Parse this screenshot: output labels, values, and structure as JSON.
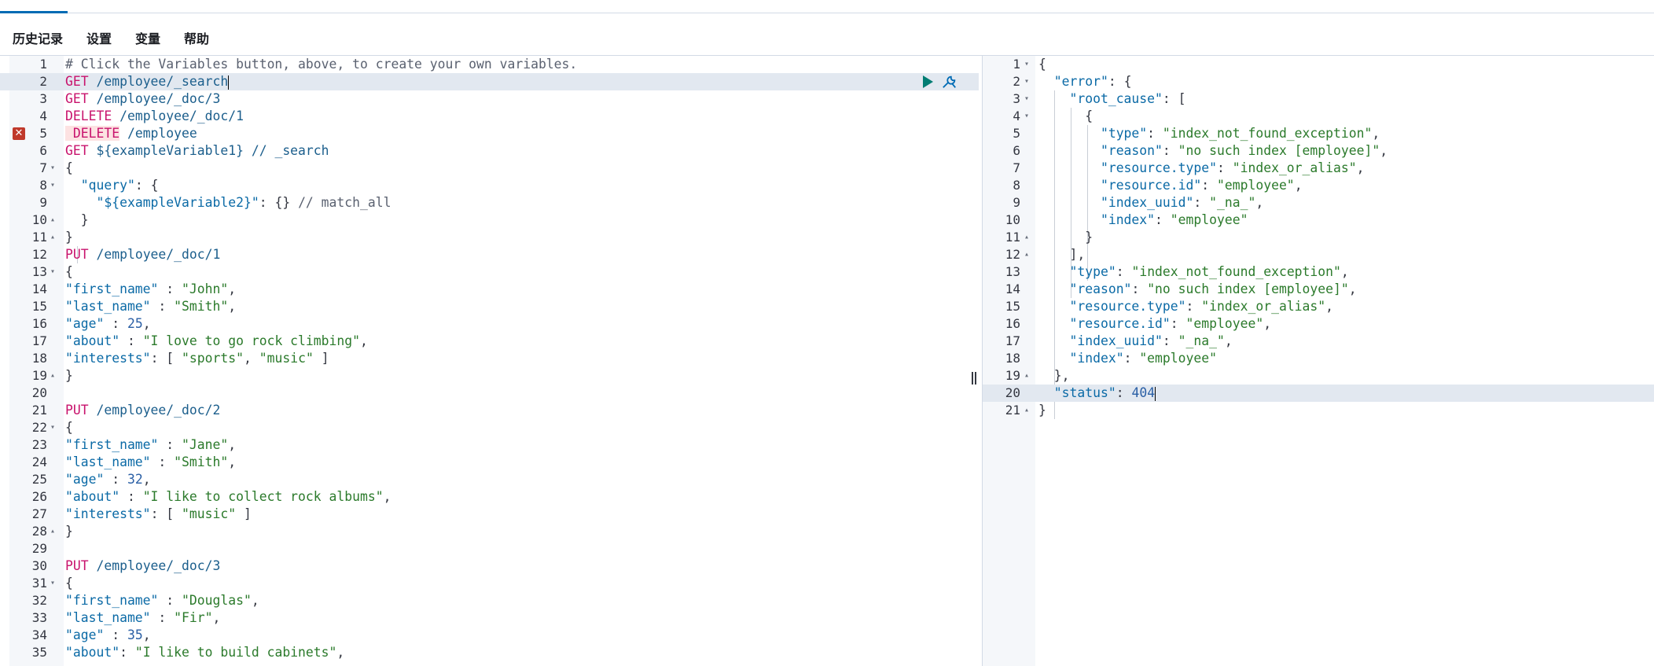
{
  "toolbar": {
    "history": "历史记录",
    "settings": "设置",
    "variables": "变量",
    "help": "帮助"
  },
  "request_editor": {
    "lines": [
      {
        "n": "1",
        "fold": "",
        "tokens": [
          {
            "c": "comment",
            "t": "# Click the Variables button, above, to create your own variables."
          }
        ]
      },
      {
        "n": "2",
        "fold": "",
        "tokens": [
          {
            "c": "method",
            "t": "GET"
          },
          {
            "c": "punct",
            "t": " "
          },
          {
            "c": "url",
            "t": "/employee/_search"
          }
        ]
      },
      {
        "n": "3",
        "fold": "",
        "tokens": [
          {
            "c": "method",
            "t": "GET"
          },
          {
            "c": "punct",
            "t": " "
          },
          {
            "c": "url",
            "t": "/employee/_doc/3"
          }
        ]
      },
      {
        "n": "4",
        "fold": "",
        "tokens": [
          {
            "c": "method",
            "t": "DELETE"
          },
          {
            "c": "punct",
            "t": " "
          },
          {
            "c": "url",
            "t": "/employee/_doc/1"
          }
        ]
      },
      {
        "n": "5",
        "fold": "",
        "tokens": [
          {
            "c": "method",
            "t": " DELETE"
          },
          {
            "c": "punct",
            "t": " "
          },
          {
            "c": "url",
            "t": "/employee"
          }
        ]
      },
      {
        "n": "6",
        "fold": "",
        "tokens": [
          {
            "c": "method",
            "t": "GET"
          },
          {
            "c": "punct",
            "t": " "
          },
          {
            "c": "url",
            "t": "${exampleVariable1} // _search"
          }
        ]
      },
      {
        "n": "7",
        "fold": "▾",
        "tokens": [
          {
            "c": "punct",
            "t": "{"
          }
        ]
      },
      {
        "n": "8",
        "fold": "▾",
        "tokens": [
          {
            "c": "punct",
            "t": "  "
          },
          {
            "c": "key",
            "t": "\"query\""
          },
          {
            "c": "punct",
            "t": ": {"
          }
        ]
      },
      {
        "n": "9",
        "fold": "",
        "tokens": [
          {
            "c": "punct",
            "t": "    "
          },
          {
            "c": "key",
            "t": "\"${exampleVariable2}\""
          },
          {
            "c": "punct",
            "t": ": {} "
          },
          {
            "c": "comment",
            "t": "// match_all"
          }
        ]
      },
      {
        "n": "10",
        "fold": "▴",
        "tokens": [
          {
            "c": "punct",
            "t": "  }"
          }
        ]
      },
      {
        "n": "11",
        "fold": "▴",
        "tokens": [
          {
            "c": "punct",
            "t": "}"
          }
        ]
      },
      {
        "n": "12",
        "fold": "",
        "tokens": [
          {
            "c": "method",
            "t": "PUT"
          },
          {
            "c": "punct",
            "t": " "
          },
          {
            "c": "url",
            "t": "/employee/_doc/1"
          }
        ]
      },
      {
        "n": "13",
        "fold": "▾",
        "tokens": [
          {
            "c": "punct",
            "t": "{"
          }
        ]
      },
      {
        "n": "14",
        "fold": "",
        "tokens": [
          {
            "c": "key",
            "t": "\"first_name\""
          },
          {
            "c": "punct",
            "t": " : "
          },
          {
            "c": "str",
            "t": "\"John\""
          },
          {
            "c": "punct",
            "t": ","
          }
        ]
      },
      {
        "n": "15",
        "fold": "",
        "tokens": [
          {
            "c": "key",
            "t": "\"last_name\""
          },
          {
            "c": "punct",
            "t": " : "
          },
          {
            "c": "str",
            "t": "\"Smith\""
          },
          {
            "c": "punct",
            "t": ","
          }
        ]
      },
      {
        "n": "16",
        "fold": "",
        "tokens": [
          {
            "c": "key",
            "t": "\"age\""
          },
          {
            "c": "punct",
            "t": " : "
          },
          {
            "c": "num",
            "t": "25"
          },
          {
            "c": "punct",
            "t": ","
          }
        ]
      },
      {
        "n": "17",
        "fold": "",
        "tokens": [
          {
            "c": "key",
            "t": "\"about\""
          },
          {
            "c": "punct",
            "t": " : "
          },
          {
            "c": "str",
            "t": "\"I love to go rock climbing\""
          },
          {
            "c": "punct",
            "t": ","
          }
        ]
      },
      {
        "n": "18",
        "fold": "",
        "tokens": [
          {
            "c": "key",
            "t": "\"interests\""
          },
          {
            "c": "punct",
            "t": ": [ "
          },
          {
            "c": "str",
            "t": "\"sports\""
          },
          {
            "c": "punct",
            "t": ", "
          },
          {
            "c": "str",
            "t": "\"music\""
          },
          {
            "c": "punct",
            "t": " ]"
          }
        ]
      },
      {
        "n": "19",
        "fold": "▴",
        "tokens": [
          {
            "c": "punct",
            "t": "}"
          }
        ]
      },
      {
        "n": "20",
        "fold": "",
        "tokens": []
      },
      {
        "n": "21",
        "fold": "",
        "tokens": [
          {
            "c": "method",
            "t": "PUT"
          },
          {
            "c": "punct",
            "t": " "
          },
          {
            "c": "url",
            "t": "/employee/_doc/2"
          }
        ]
      },
      {
        "n": "22",
        "fold": "▾",
        "tokens": [
          {
            "c": "punct",
            "t": "{"
          }
        ]
      },
      {
        "n": "23",
        "fold": "",
        "tokens": [
          {
            "c": "key",
            "t": "\"first_name\""
          },
          {
            "c": "punct",
            "t": " : "
          },
          {
            "c": "str",
            "t": "\"Jane\""
          },
          {
            "c": "punct",
            "t": ","
          }
        ]
      },
      {
        "n": "24",
        "fold": "",
        "tokens": [
          {
            "c": "key",
            "t": "\"last_name\""
          },
          {
            "c": "punct",
            "t": " : "
          },
          {
            "c": "str",
            "t": "\"Smith\""
          },
          {
            "c": "punct",
            "t": ","
          }
        ]
      },
      {
        "n": "25",
        "fold": "",
        "tokens": [
          {
            "c": "key",
            "t": "\"age\""
          },
          {
            "c": "punct",
            "t": " : "
          },
          {
            "c": "num",
            "t": "32"
          },
          {
            "c": "punct",
            "t": ","
          }
        ]
      },
      {
        "n": "26",
        "fold": "",
        "tokens": [
          {
            "c": "key",
            "t": "\"about\""
          },
          {
            "c": "punct",
            "t": " : "
          },
          {
            "c": "str",
            "t": "\"I like to collect rock albums\""
          },
          {
            "c": "punct",
            "t": ","
          }
        ]
      },
      {
        "n": "27",
        "fold": "",
        "tokens": [
          {
            "c": "key",
            "t": "\"interests\""
          },
          {
            "c": "punct",
            "t": ": [ "
          },
          {
            "c": "str",
            "t": "\"music\""
          },
          {
            "c": "punct",
            "t": " ]"
          }
        ]
      },
      {
        "n": "28",
        "fold": "▴",
        "tokens": [
          {
            "c": "punct",
            "t": "}"
          }
        ]
      },
      {
        "n": "29",
        "fold": "",
        "tokens": []
      },
      {
        "n": "30",
        "fold": "",
        "tokens": [
          {
            "c": "method",
            "t": "PUT"
          },
          {
            "c": "punct",
            "t": " "
          },
          {
            "c": "url",
            "t": "/employee/_doc/3"
          }
        ]
      },
      {
        "n": "31",
        "fold": "▾",
        "tokens": [
          {
            "c": "punct",
            "t": "{"
          }
        ]
      },
      {
        "n": "32",
        "fold": "",
        "tokens": [
          {
            "c": "key",
            "t": "\"first_name\""
          },
          {
            "c": "punct",
            "t": " : "
          },
          {
            "c": "str",
            "t": "\"Douglas\""
          },
          {
            "c": "punct",
            "t": ","
          }
        ]
      },
      {
        "n": "33",
        "fold": "",
        "tokens": [
          {
            "c": "key",
            "t": "\"last_name\""
          },
          {
            "c": "punct",
            "t": " : "
          },
          {
            "c": "str",
            "t": "\"Fir\""
          },
          {
            "c": "punct",
            "t": ","
          }
        ]
      },
      {
        "n": "34",
        "fold": "",
        "tokens": [
          {
            "c": "key",
            "t": "\"age\""
          },
          {
            "c": "punct",
            "t": " : "
          },
          {
            "c": "num",
            "t": "35"
          },
          {
            "c": "punct",
            "t": ","
          }
        ]
      },
      {
        "n": "35",
        "fold": "",
        "tokens": [
          {
            "c": "key",
            "t": "\"about\""
          },
          {
            "c": "punct",
            "t": ": "
          },
          {
            "c": "str",
            "t": "\"I like to build cabinets\""
          },
          {
            "c": "punct",
            "t": ","
          }
        ]
      }
    ]
  },
  "response_viewer": {
    "lines": [
      {
        "n": "1",
        "fold": "▾",
        "tokens": [
          {
            "c": "punct",
            "t": "{"
          }
        ]
      },
      {
        "n": "2",
        "fold": "▾",
        "tokens": [
          {
            "c": "punct",
            "t": "  "
          },
          {
            "c": "key",
            "t": "\"error\""
          },
          {
            "c": "punct",
            "t": ": {"
          }
        ]
      },
      {
        "n": "3",
        "fold": "▾",
        "tokens": [
          {
            "c": "punct",
            "t": "    "
          },
          {
            "c": "key",
            "t": "\"root_cause\""
          },
          {
            "c": "punct",
            "t": ": ["
          }
        ]
      },
      {
        "n": "4",
        "fold": "▾",
        "tokens": [
          {
            "c": "punct",
            "t": "      {"
          }
        ]
      },
      {
        "n": "5",
        "fold": "",
        "tokens": [
          {
            "c": "punct",
            "t": "        "
          },
          {
            "c": "key",
            "t": "\"type\""
          },
          {
            "c": "punct",
            "t": ": "
          },
          {
            "c": "str",
            "t": "\"index_not_found_exception\""
          },
          {
            "c": "punct",
            "t": ","
          }
        ]
      },
      {
        "n": "6",
        "fold": "",
        "tokens": [
          {
            "c": "punct",
            "t": "        "
          },
          {
            "c": "key",
            "t": "\"reason\""
          },
          {
            "c": "punct",
            "t": ": "
          },
          {
            "c": "str",
            "t": "\"no such index [employee]\""
          },
          {
            "c": "punct",
            "t": ","
          }
        ]
      },
      {
        "n": "7",
        "fold": "",
        "tokens": [
          {
            "c": "punct",
            "t": "        "
          },
          {
            "c": "key",
            "t": "\"resource.type\""
          },
          {
            "c": "punct",
            "t": ": "
          },
          {
            "c": "str",
            "t": "\"index_or_alias\""
          },
          {
            "c": "punct",
            "t": ","
          }
        ]
      },
      {
        "n": "8",
        "fold": "",
        "tokens": [
          {
            "c": "punct",
            "t": "        "
          },
          {
            "c": "key",
            "t": "\"resource.id\""
          },
          {
            "c": "punct",
            "t": ": "
          },
          {
            "c": "str",
            "t": "\"employee\""
          },
          {
            "c": "punct",
            "t": ","
          }
        ]
      },
      {
        "n": "9",
        "fold": "",
        "tokens": [
          {
            "c": "punct",
            "t": "        "
          },
          {
            "c": "key",
            "t": "\"index_uuid\""
          },
          {
            "c": "punct",
            "t": ": "
          },
          {
            "c": "str",
            "t": "\"_na_\""
          },
          {
            "c": "punct",
            "t": ","
          }
        ]
      },
      {
        "n": "10",
        "fold": "",
        "tokens": [
          {
            "c": "punct",
            "t": "        "
          },
          {
            "c": "key",
            "t": "\"index\""
          },
          {
            "c": "punct",
            "t": ": "
          },
          {
            "c": "str",
            "t": "\"employee\""
          }
        ]
      },
      {
        "n": "11",
        "fold": "▴",
        "tokens": [
          {
            "c": "punct",
            "t": "      }"
          }
        ]
      },
      {
        "n": "12",
        "fold": "▴",
        "tokens": [
          {
            "c": "punct",
            "t": "    ],"
          }
        ]
      },
      {
        "n": "13",
        "fold": "",
        "tokens": [
          {
            "c": "punct",
            "t": "    "
          },
          {
            "c": "key",
            "t": "\"type\""
          },
          {
            "c": "punct",
            "t": ": "
          },
          {
            "c": "str",
            "t": "\"index_not_found_exception\""
          },
          {
            "c": "punct",
            "t": ","
          }
        ]
      },
      {
        "n": "14",
        "fold": "",
        "tokens": [
          {
            "c": "punct",
            "t": "    "
          },
          {
            "c": "key",
            "t": "\"reason\""
          },
          {
            "c": "punct",
            "t": ": "
          },
          {
            "c": "str",
            "t": "\"no such index [employee]\""
          },
          {
            "c": "punct",
            "t": ","
          }
        ]
      },
      {
        "n": "15",
        "fold": "",
        "tokens": [
          {
            "c": "punct",
            "t": "    "
          },
          {
            "c": "key",
            "t": "\"resource.type\""
          },
          {
            "c": "punct",
            "t": ": "
          },
          {
            "c": "str",
            "t": "\"index_or_alias\""
          },
          {
            "c": "punct",
            "t": ","
          }
        ]
      },
      {
        "n": "16",
        "fold": "",
        "tokens": [
          {
            "c": "punct",
            "t": "    "
          },
          {
            "c": "key",
            "t": "\"resource.id\""
          },
          {
            "c": "punct",
            "t": ": "
          },
          {
            "c": "str",
            "t": "\"employee\""
          },
          {
            "c": "punct",
            "t": ","
          }
        ]
      },
      {
        "n": "17",
        "fold": "",
        "tokens": [
          {
            "c": "punct",
            "t": "    "
          },
          {
            "c": "key",
            "t": "\"index_uuid\""
          },
          {
            "c": "punct",
            "t": ": "
          },
          {
            "c": "str",
            "t": "\"_na_\""
          },
          {
            "c": "punct",
            "t": ","
          }
        ]
      },
      {
        "n": "18",
        "fold": "",
        "tokens": [
          {
            "c": "punct",
            "t": "    "
          },
          {
            "c": "key",
            "t": "\"index\""
          },
          {
            "c": "punct",
            "t": ": "
          },
          {
            "c": "str",
            "t": "\"employee\""
          }
        ]
      },
      {
        "n": "19",
        "fold": "▴",
        "tokens": [
          {
            "c": "punct",
            "t": "  },"
          }
        ]
      },
      {
        "n": "20",
        "fold": "",
        "tokens": [
          {
            "c": "punct",
            "t": "  "
          },
          {
            "c": "key",
            "t": "\"status\""
          },
          {
            "c": "punct",
            "t": ": "
          },
          {
            "c": "num",
            "t": "404"
          }
        ]
      },
      {
        "n": "21",
        "fold": "▴",
        "tokens": [
          {
            "c": "punct",
            "t": "}"
          }
        ]
      }
    ]
  },
  "icons": {
    "run": "play-icon",
    "settings": "wrench-icon",
    "error": "error-icon",
    "splitter": "resize-handle-icon"
  },
  "colors": {
    "accent": "#006bb4",
    "method": "#c8126c",
    "key": "#0b6aa6",
    "string": "#2b7a2b",
    "number": "#2a5fa5",
    "run": "#017d73",
    "error": "#c0392b",
    "active_line": "#e2e8f0"
  }
}
